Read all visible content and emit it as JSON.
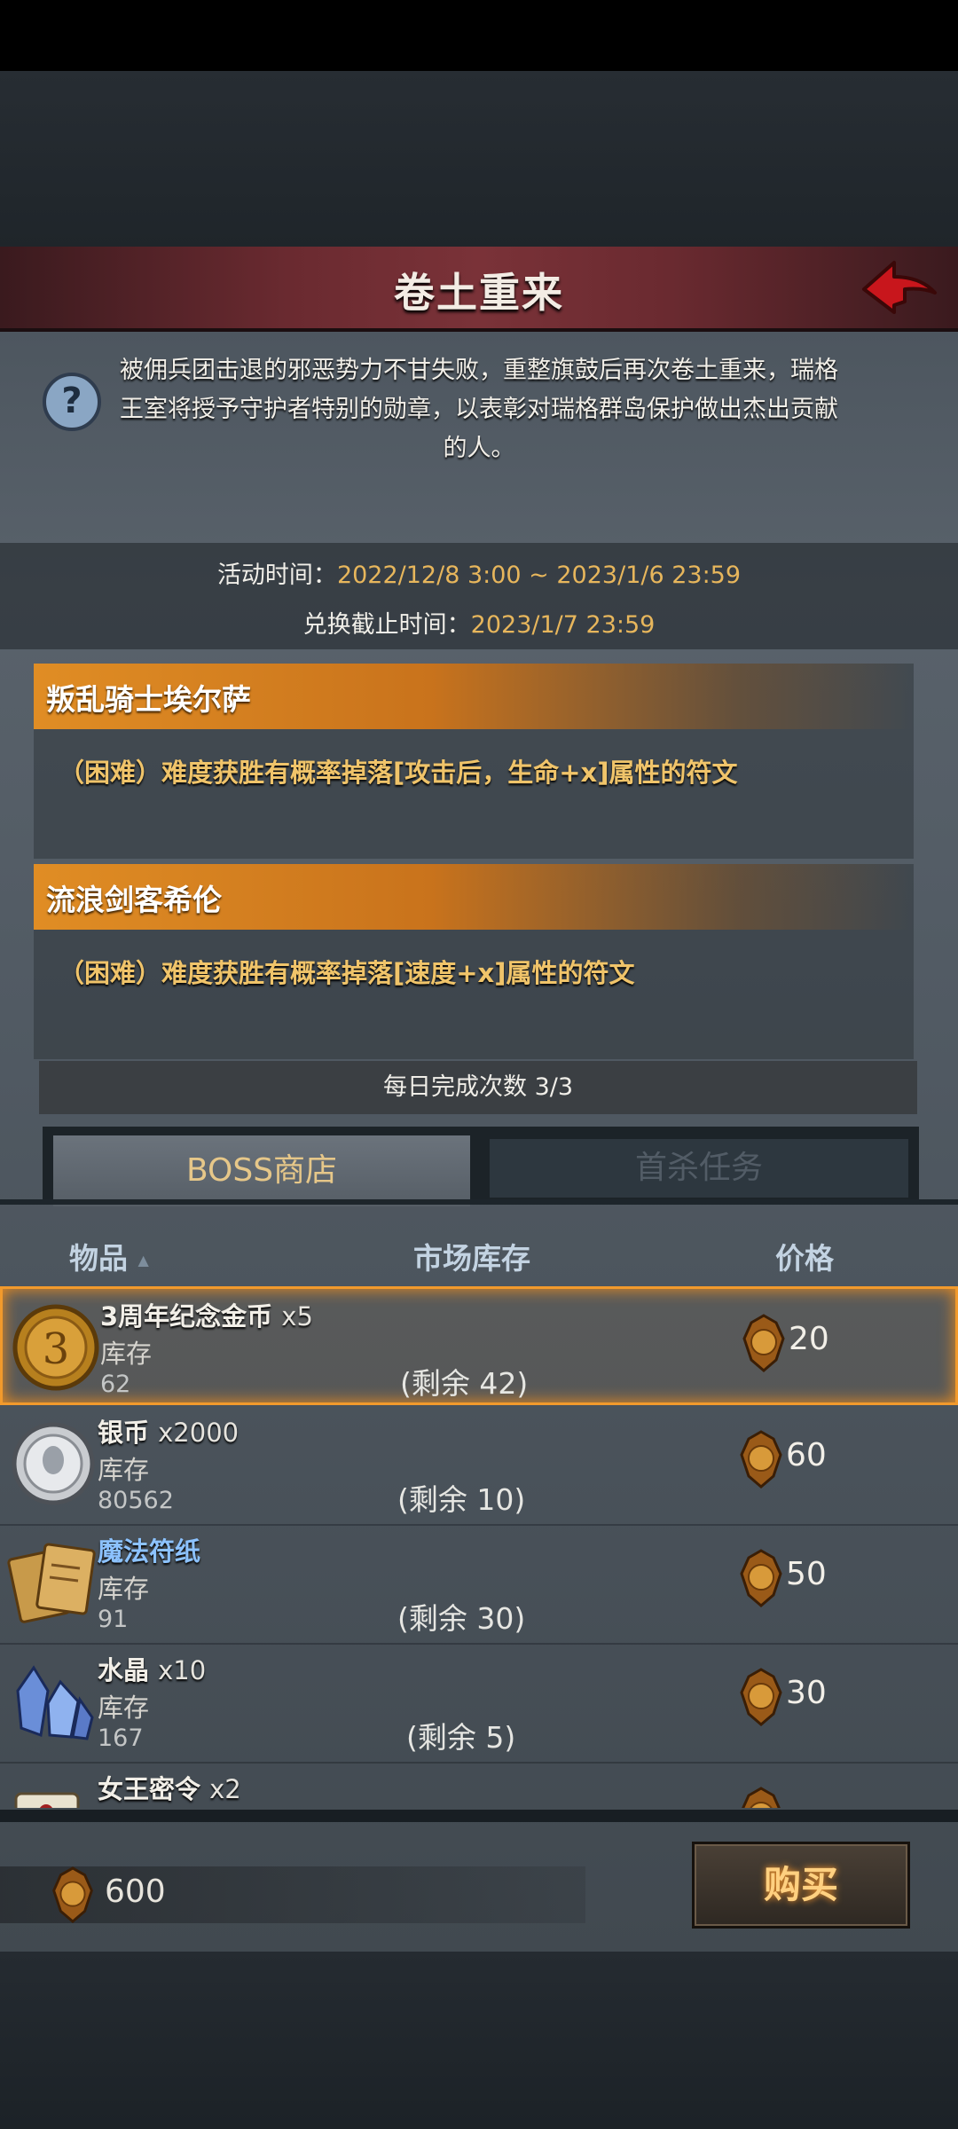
{
  "header": {
    "title": "卷土重来"
  },
  "intro": {
    "text": "被佣兵团击退的邪恶势力不甘失败，重整旗鼓后再次卷土重来，瑞格王室将授予守护者特别的勋章，以表彰对瑞格群岛保护做出杰出贡献的人。"
  },
  "event_time": {
    "label": "活动时间：",
    "value": "2022/12/8 3:00 ~ 2023/1/6 23:59",
    "exchange_label": "兑换截止时间：",
    "exchange_value": "2023/1/7 23:59"
  },
  "bosses": [
    {
      "name": "叛乱骑士埃尔萨",
      "desc": "（困难）难度获胜有概率掉落[攻击后，生命+x]属性的符文"
    },
    {
      "name": "流浪剑客希伦",
      "desc": "（困难）难度获胜有概率掉落[速度+x]属性的符文"
    }
  ],
  "daily": {
    "label": "每日完成次数",
    "value": "3/3"
  },
  "tabs": [
    {
      "label": "BOSS商店",
      "active": true
    },
    {
      "label": "首杀任务",
      "active": false
    }
  ],
  "columns": {
    "item": "物品",
    "item_sort": "▲",
    "stock": "市场库存",
    "price": "价格"
  },
  "items": [
    {
      "name": "3周年纪念金币",
      "qty": "x5",
      "stock_label": "库存",
      "stock": "62",
      "remain": "(剩余 42)",
      "price": "20",
      "icon": "anniversary-coin-icon"
    },
    {
      "name": "银币",
      "qty": "x2000",
      "stock_label": "库存",
      "stock": "80562",
      "remain": "(剩余 10)",
      "price": "60",
      "icon": "silver-coin-icon"
    },
    {
      "name": "魔法符纸",
      "qty": "",
      "stock_label": "库存",
      "stock": "91",
      "remain": "(剩余 30)",
      "price": "50",
      "icon": "magic-paper-icon"
    },
    {
      "name": "水晶",
      "qty": "x10",
      "stock_label": "库存",
      "stock": "167",
      "remain": "(剩余 5)",
      "price": "30",
      "icon": "crystal-icon"
    },
    {
      "name": "女王密令",
      "qty": "x2",
      "stock_label": "",
      "stock": "",
      "remain": "",
      "price": "",
      "icon": "queen-order-icon"
    }
  ],
  "footer": {
    "gold": "600",
    "buy_label": "购买"
  },
  "colors": {
    "accent_orange": "#e08d24",
    "price_gold": "#e7b65c",
    "blue_name": "#8cc2ff"
  }
}
